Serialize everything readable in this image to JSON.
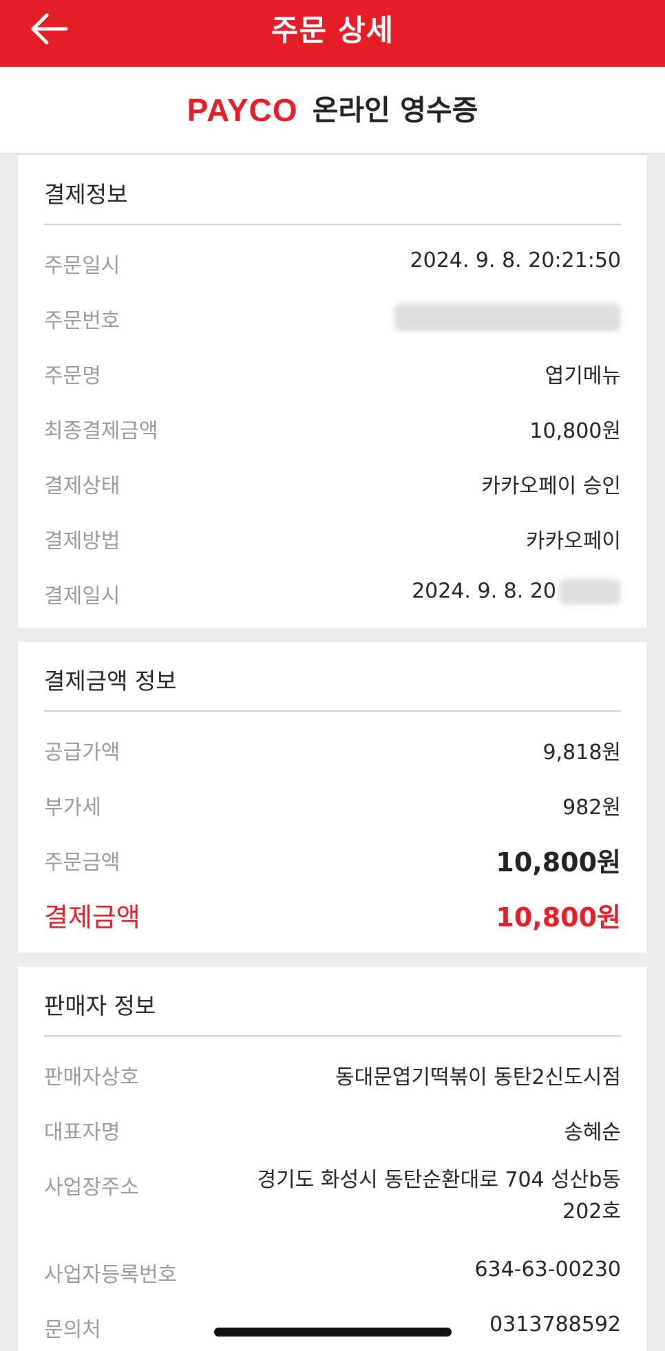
{
  "header": {
    "title": "주문 상세",
    "back_icon": "arrow-left-icon"
  },
  "receipt_head": {
    "logo_text": "PAYCO",
    "title": "온라인 영수증",
    "brand_color": "#e41d26"
  },
  "payment_info": {
    "title": "결제정보",
    "rows": [
      {
        "label": "주문일시",
        "value": "2024. 9. 8. 20:21:50"
      },
      {
        "label": "주문번호",
        "value": ""
      },
      {
        "label": "주문명",
        "value": "엽기메뉴"
      },
      {
        "label": "최종결제금액",
        "value": "10,800원"
      },
      {
        "label": "결제상태",
        "value": "카카오페이 승인"
      },
      {
        "label": "결제방법",
        "value": "카카오페이"
      },
      {
        "label": "결제일시",
        "value": "2024. 9. 8. 20"
      }
    ]
  },
  "amount_info": {
    "title": "결제금액 정보",
    "rows": [
      {
        "label": "공급가액",
        "value": "9,818원"
      },
      {
        "label": "부가세",
        "value": "982원"
      },
      {
        "label": "주문금액",
        "value": "10,800원"
      },
      {
        "label": "결제금액",
        "value": "10,800원"
      }
    ]
  },
  "seller_info": {
    "title": "판매자 정보",
    "rows": [
      {
        "label": "판매자상호",
        "value": "동대문엽기떡볶이 동탄2신도시점"
      },
      {
        "label": "대표자명",
        "value": "송혜순"
      },
      {
        "label": "사업장주소",
        "value": "경기도 화성시 동탄순환대로 704 성산b동",
        "value2": "202호"
      },
      {
        "label": "사업자등록번호",
        "value": "634-63-00230"
      },
      {
        "label": "문의처",
        "value": "0313788592"
      }
    ]
  }
}
